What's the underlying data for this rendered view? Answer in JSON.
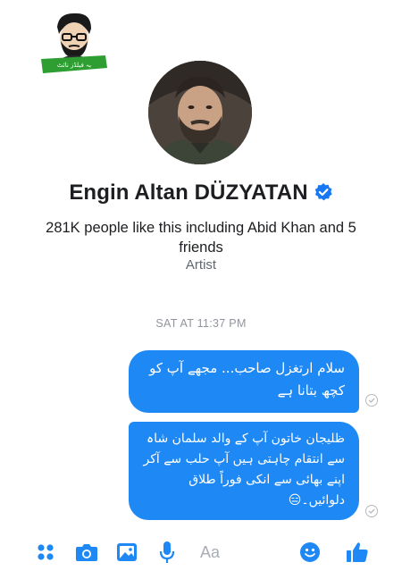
{
  "header": {
    "logo_text": "بہ فیلڈز نائٹ",
    "page_name": "Engin Altan DÜZYATAN",
    "likes_text": "281K people like this including Abid Khan and 5 friends",
    "category": "Artist"
  },
  "conversation": {
    "timestamp": "SAT AT 11:37 PM",
    "messages": [
      {
        "text": "سلام ارتغزل صاحب... مجھے آپ کو کچھ بتانا ہے",
        "status": "sent"
      },
      {
        "text": "ظلیجان خاتون آپ کے والد سلمان شاہ سے انتقام چاہتی ہیں آپ حلب سے آکر اپنے بھائی سے انکی فوراً طلاق دلوائیں۔😑",
        "status": "sent"
      }
    ]
  },
  "composer": {
    "placeholder": "Aa",
    "icons": [
      "more-apps-icon",
      "camera-icon",
      "gallery-icon",
      "microphone-icon",
      "emoji-icon",
      "thumbs-up-icon"
    ]
  },
  "colors": {
    "accent": "#1e88f5",
    "verified": "#1877f2",
    "logo_green": "#2e9e32"
  }
}
